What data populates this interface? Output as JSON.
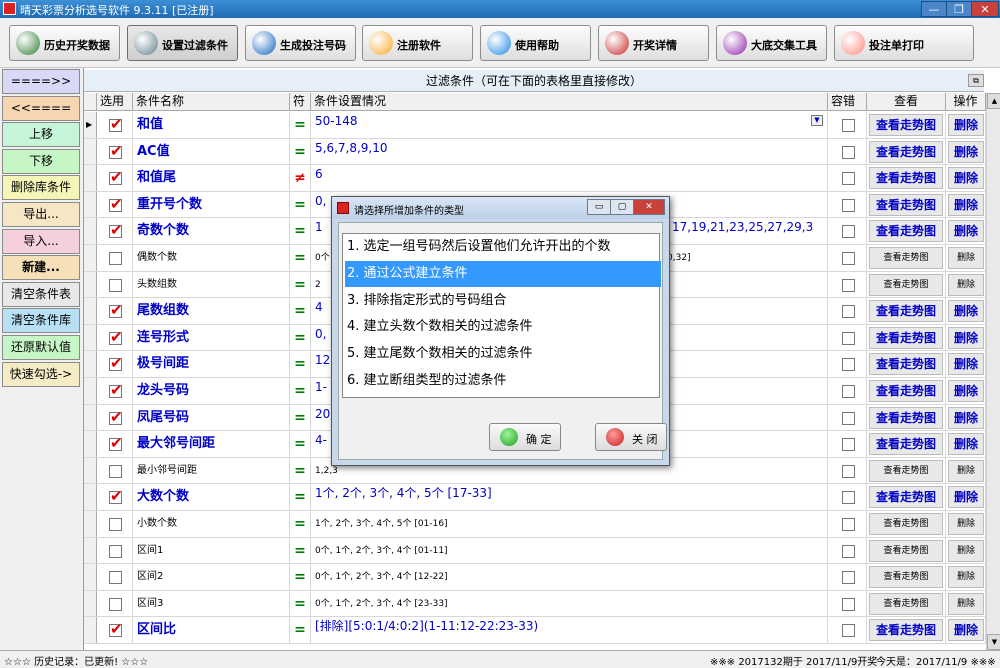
{
  "window": {
    "title": "晴天彩票分析选号软件 9.3.11 [已注册]",
    "min_glyph": "—",
    "max_glyph": "❐",
    "close_glyph": "✕"
  },
  "toolbar": {
    "items": [
      {
        "label": "历史开奖数据",
        "icon": "book-icon",
        "color": "#2e7d32"
      },
      {
        "label": "设置过滤条件",
        "icon": "tools-icon",
        "color": "#607d8b"
      },
      {
        "label": "生成投注号码",
        "icon": "globe-icon",
        "color": "#1565c0"
      },
      {
        "label": "注册软件",
        "icon": "key-icon",
        "color": "#f9a825"
      },
      {
        "label": "使用帮助",
        "icon": "help-icon",
        "color": "#1e88e5"
      },
      {
        "label": "开奖详情",
        "icon": "question-icon",
        "color": "#c62828"
      },
      {
        "label": "大底交集工具",
        "icon": "pie-chart-icon",
        "color": "#8e24aa"
      },
      {
        "label": "投注单打印",
        "icon": "print-icon",
        "color": "#ff8a80"
      }
    ]
  },
  "leftpanel": {
    "items": [
      {
        "label": "====>>",
        "bg": "#d9d9f7"
      },
      {
        "label": "<<====",
        "bg": "#f5d6b0"
      },
      {
        "label": "上移",
        "bg": "#c6f5d9"
      },
      {
        "label": "下移",
        "bg": "#c6f5c6"
      },
      {
        "label": "删除库条件",
        "bg": "#f5f5b8"
      },
      {
        "label": "导出...",
        "bg": "#f5e6c6"
      },
      {
        "label": "导入...",
        "bg": "#f5cfd9"
      },
      {
        "label": "新建...",
        "bg": "#f5e0b8"
      },
      {
        "label": "清空条件表",
        "bg": "#e8e8e8"
      },
      {
        "label": "清空条件库",
        "bg": "#b8e0f5"
      },
      {
        "label": "还原默认值",
        "bg": "#c6f5c6"
      },
      {
        "label": "快速勾选->",
        "bg": "#f5ecc6"
      }
    ]
  },
  "grid": {
    "title": "过滤条件（可在下面的表格里直接修改）",
    "title_icon": "⧉",
    "headers": [
      "选用",
      "条件名称",
      "符",
      "条件设置情况",
      "容错",
      "查看",
      "操作"
    ],
    "scroll_up": "▲",
    "scroll_down": "▼",
    "current_row_marker": "▶",
    "rows": [
      {
        "checked": true,
        "name": "和值",
        "sym": "=",
        "setting": "50-148",
        "style": "big",
        "view": "查看走势图",
        "op": "删除",
        "current": true
      },
      {
        "checked": true,
        "name": "AC值",
        "sym": "=",
        "setting": "5,6,7,8,9,10",
        "style": "big",
        "view": "查看走势图",
        "op": "删除"
      },
      {
        "checked": true,
        "name": "和值尾",
        "sym": "≠",
        "setting": "6",
        "style": "big",
        "view": "查看走势图",
        "op": "删除"
      },
      {
        "checked": true,
        "name": "重开号个数",
        "sym": "=",
        "setting": "0,",
        "style": "big",
        "view": "查看走势图",
        "op": "删除"
      },
      {
        "checked": true,
        "name": "奇数个数",
        "sym": "=",
        "setting": "1",
        "setting_tail": "17,19,21,23,25,27,29,3",
        "style": "big",
        "view": "查看走势图",
        "op": "删除"
      },
      {
        "checked": false,
        "name": "偶数个数",
        "sym": "=",
        "setting": "0个",
        "setting_tail": "0,32]",
        "style": "small",
        "view": "查看走势图",
        "op": "删除"
      },
      {
        "checked": false,
        "name": "头数组数",
        "sym": "=",
        "setting": "2",
        "style": "small",
        "view": "查看走势图",
        "op": "删除"
      },
      {
        "checked": true,
        "name": "尾数组数",
        "sym": "=",
        "setting": "4",
        "style": "big",
        "view": "查看走势图",
        "op": "删除"
      },
      {
        "checked": true,
        "name": "连号形式",
        "sym": "=",
        "setting": "0,",
        "style": "big",
        "view": "查看走势图",
        "op": "删除"
      },
      {
        "checked": true,
        "name": "极号间距",
        "sym": "=",
        "setting": "12",
        "style": "big",
        "view": "查看走势图",
        "op": "删除"
      },
      {
        "checked": true,
        "name": "龙头号码",
        "sym": "=",
        "setting": "1-",
        "style": "big",
        "view": "查看走势图",
        "op": "删除"
      },
      {
        "checked": true,
        "name": "凤尾号码",
        "sym": "=",
        "setting": "20",
        "style": "big",
        "view": "查看走势图",
        "op": "删除"
      },
      {
        "checked": true,
        "name": "最大邻号间距",
        "sym": "=",
        "setting": "4-",
        "style": "big",
        "view": "查看走势图",
        "op": "删除"
      },
      {
        "checked": false,
        "name": "最小邻号间距",
        "sym": "=",
        "setting": "1,2,3",
        "style": "small",
        "view": "查看走势图",
        "op": "删除"
      },
      {
        "checked": true,
        "name": "大数个数",
        "sym": "=",
        "setting": "1个, 2个, 3个, 4个, 5个    [17-33]",
        "style": "big",
        "view": "查看走势图",
        "op": "删除"
      },
      {
        "checked": false,
        "name": "小数个数",
        "sym": "=",
        "setting": "1个, 2个, 3个, 4个, 5个    [01-16]",
        "style": "small",
        "view": "查看走势图",
        "op": "删除"
      },
      {
        "checked": false,
        "name": "区间1",
        "sym": "=",
        "setting": "0个, 1个, 2个, 3个, 4个    [01-11]",
        "style": "small",
        "view": "查看走势图",
        "op": "删除"
      },
      {
        "checked": false,
        "name": "区间2",
        "sym": "=",
        "setting": "0个, 1个, 2个, 3个, 4个    [12-22]",
        "style": "small",
        "view": "查看走势图",
        "op": "删除"
      },
      {
        "checked": false,
        "name": "区间3",
        "sym": "=",
        "setting": "0个, 1个, 2个, 3个, 4个    [23-33]",
        "style": "small",
        "view": "查看走势图",
        "op": "删除"
      },
      {
        "checked": true,
        "name": "区间比",
        "sym": "=",
        "setting": "[排除][5:0:1/4:0:2](1-11:12-22:23-33)",
        "style": "big",
        "view": "查看走势图",
        "op": "删除"
      }
    ]
  },
  "dialog": {
    "title": "请选择所增加条件的类型",
    "min_glyph": "▭",
    "max_glyph": "▢",
    "close_glyph": "✕",
    "options": [
      "1. 选定一组号码然后设置他们允许开出的个数",
      "2. 通过公式建立条件",
      "3. 排除指定形式的号码组合",
      "4. 建立头数个数相关的过滤条件",
      "5. 建立尾数个数相关的过滤条件",
      "6. 建立断组类型的过滤条件"
    ],
    "selected_index": 1,
    "ok_label": "确 定",
    "close_label": "关 闭"
  },
  "statusbar": {
    "left": "☆☆☆  历史记录：已更新!  ☆☆☆",
    "mid": "※※※  2017132期于 2017/11/9开奖",
    "right": "今天是：2017/11/9  ※※※"
  }
}
